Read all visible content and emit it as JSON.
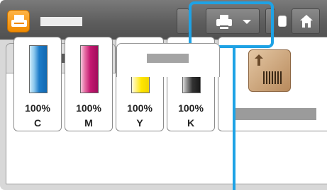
{
  "window": {
    "app_icon": "printer-app-icon",
    "title_text": ""
  },
  "toolbar": {
    "printer_icon": "printer-icon",
    "dropdown_icon": "chevron-down-icon",
    "home_icon": "home-icon"
  },
  "tabs": [
    {
      "label": ""
    },
    {
      "label": "",
      "selected": true
    },
    {
      "label": ""
    }
  ],
  "consumables": [
    {
      "percent": "100%",
      "name": "C",
      "color": "#1d7cc9"
    },
    {
      "percent": "100%",
      "name": "M",
      "color": "#c41870"
    },
    {
      "percent": "100%",
      "name": "Y",
      "color": "#ffe600"
    },
    {
      "percent": "100%",
      "name": "K",
      "color": "#333333"
    }
  ],
  "tray": {
    "icon": "paper-box-icon",
    "label": ""
  },
  "annotation": {
    "highlight_color": "#1ea2e5",
    "target": "printer-selector"
  }
}
